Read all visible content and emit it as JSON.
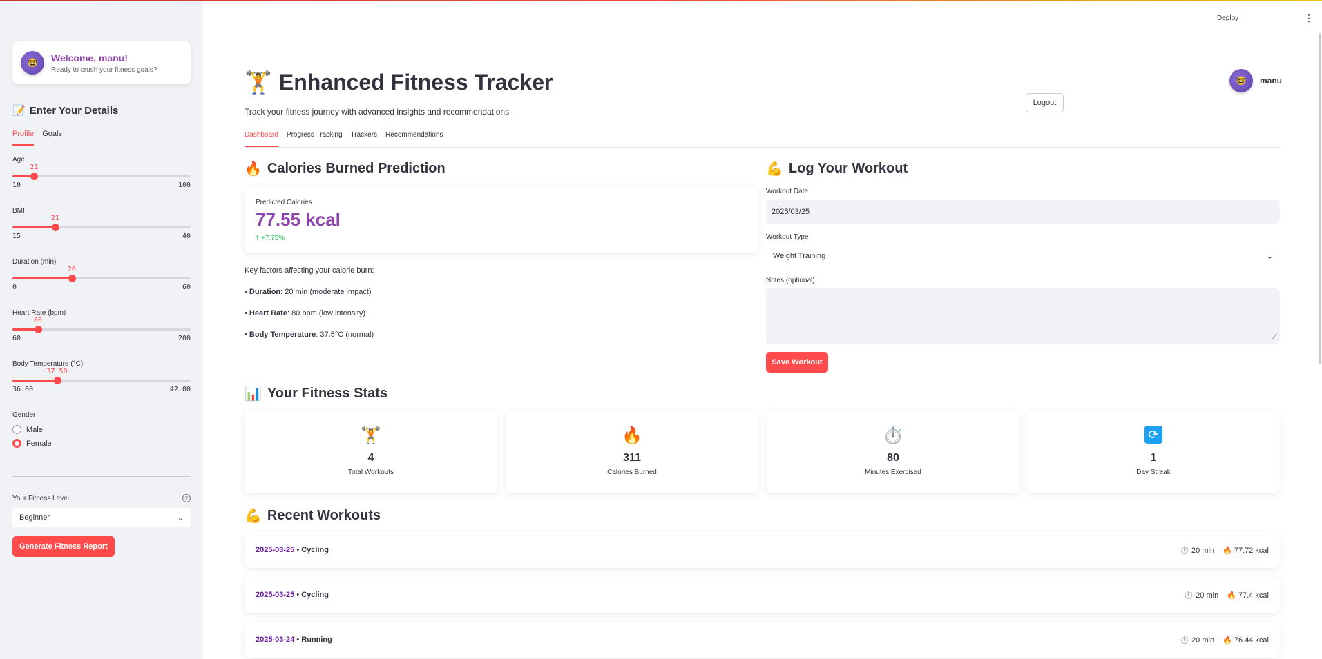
{
  "header": {
    "deploy": "Deploy",
    "menu_icon": "kebab-icon"
  },
  "sidebar": {
    "welcome": {
      "title": "Welcome, manu!",
      "subtitle": "Ready to crush your fitness goals?"
    },
    "heading": "Enter Your Details",
    "tabs": [
      {
        "label": "Profile",
        "active": true
      },
      {
        "label": "Goals",
        "active": false
      }
    ],
    "sliders": [
      {
        "label": "Age",
        "value": "21",
        "min": "10",
        "max": "100",
        "fraction": 0.122
      },
      {
        "label": "BMI",
        "value": "21",
        "min": "15",
        "max": "40",
        "fraction": 0.24
      },
      {
        "label": "Duration (min)",
        "value": "20",
        "min": "0",
        "max": "60",
        "fraction": 0.333
      },
      {
        "label": "Heart Rate (bpm)",
        "value": "80",
        "min": "60",
        "max": "200",
        "fraction": 0.143
      },
      {
        "label": "Body Temperature (°C)",
        "value": "37.50",
        "min": "36.00",
        "max": "42.00",
        "fraction": 0.25
      }
    ],
    "gender": {
      "label": "Gender",
      "options": [
        "Male",
        "Female"
      ],
      "selected": "Female"
    },
    "fitness_level": {
      "label": "Your Fitness Level",
      "value": "Beginner"
    },
    "generate_button": "Generate Fitness Report"
  },
  "main": {
    "title": "Enhanced Fitness Tracker",
    "subtitle": "Track your fitness journey with advanced insights and recommendations",
    "user": {
      "name": "manu"
    },
    "logout": "Logout",
    "tabs": [
      {
        "label": "Dashboard",
        "active": true
      },
      {
        "label": "Progress Tracking",
        "active": false
      },
      {
        "label": "Trackers",
        "active": false
      },
      {
        "label": "Recommendations",
        "active": false
      }
    ],
    "prediction": {
      "heading": "Calories Burned Prediction",
      "label": "Predicted Calories",
      "value": "77.55 kcal",
      "delta": "+7.75%",
      "factors_intro": "Key factors affecting your calorie burn:",
      "factors": [
        {
          "name": "Duration",
          "text": ": 20 min (moderate impact)"
        },
        {
          "name": "Heart Rate",
          "text": ": 80 bpm (low intensity)"
        },
        {
          "name": "Body Temperature",
          "text": ": 37.5°C (normal)"
        }
      ]
    },
    "log": {
      "heading": "Log Your Workout",
      "date_label": "Workout Date",
      "date_value": "2025/03/25",
      "type_label": "Workout Type",
      "type_value": "Weight Training",
      "notes_label": "Notes (optional)",
      "notes_value": "",
      "save": "Save Workout"
    },
    "stats": {
      "heading": "Your Fitness Stats",
      "cards": [
        {
          "value": "4",
          "label": "Total Workouts",
          "icon": "weightlifter-icon"
        },
        {
          "value": "311",
          "label": "Calories Burned",
          "icon": "fire-icon"
        },
        {
          "value": "80",
          "label": "Minutes Exercised",
          "icon": "stopwatch-icon"
        },
        {
          "value": "1",
          "label": "Day Streak",
          "icon": "sync-icon"
        }
      ]
    },
    "recent": {
      "heading": "Recent Workouts",
      "items": [
        {
          "date": "2025-03-25",
          "sep": " • ",
          "type": "Cycling",
          "duration": "20 min",
          "calories": "77.72 kcal"
        },
        {
          "date": "2025-03-25",
          "sep": " • ",
          "type": "Cycling",
          "duration": "20 min",
          "calories": "77.4 kcal"
        },
        {
          "date": "2025-03-24",
          "sep": " • ",
          "type": "Running",
          "duration": "20 min",
          "calories": "76.44 kcal"
        }
      ]
    }
  }
}
